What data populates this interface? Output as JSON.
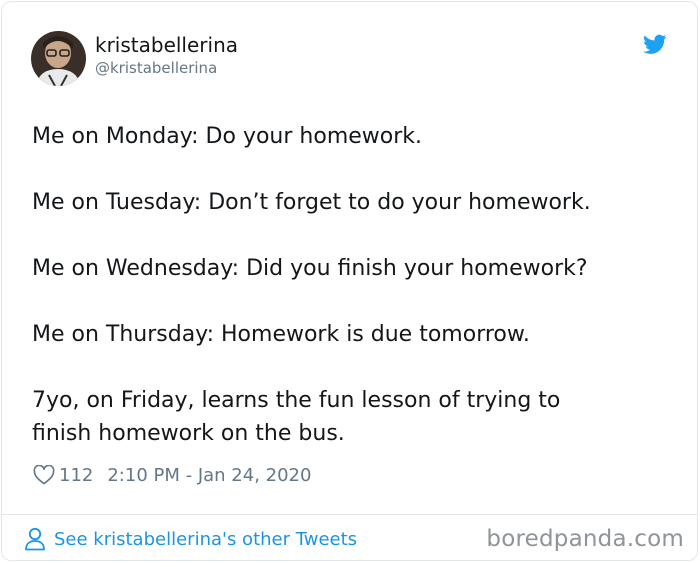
{
  "author": {
    "name": "kristabellerina",
    "handle": "@kristabellerina",
    "avatar": "avatar-photo"
  },
  "brand_icon": "twitter-bird-icon",
  "tweet": {
    "lines": [
      "Me on Monday: Do your homework.",
      "Me on Tuesday: Don’t forget to do your homework.",
      "Me on Wednesday: Did you finish your homework?",
      "Me on Thursday: Homework is due tomorrow.",
      "7yo, on Friday, learns the fun lesson of trying to\nfinish homework on the bus."
    ]
  },
  "meta": {
    "like_icon": "heart-icon",
    "likes": "112",
    "timestamp": "2:10 PM - Jan 24, 2020"
  },
  "footer": {
    "link_icon": "person-icon",
    "link_text": "See kristabellerina's other Tweets"
  },
  "watermark": "boredpanda.com",
  "colors": {
    "text": "#14171a",
    "secondary": "#657786",
    "link": "#1b95e0",
    "twitter_blue": "#1da1f2",
    "border": "#e1e8ed"
  }
}
